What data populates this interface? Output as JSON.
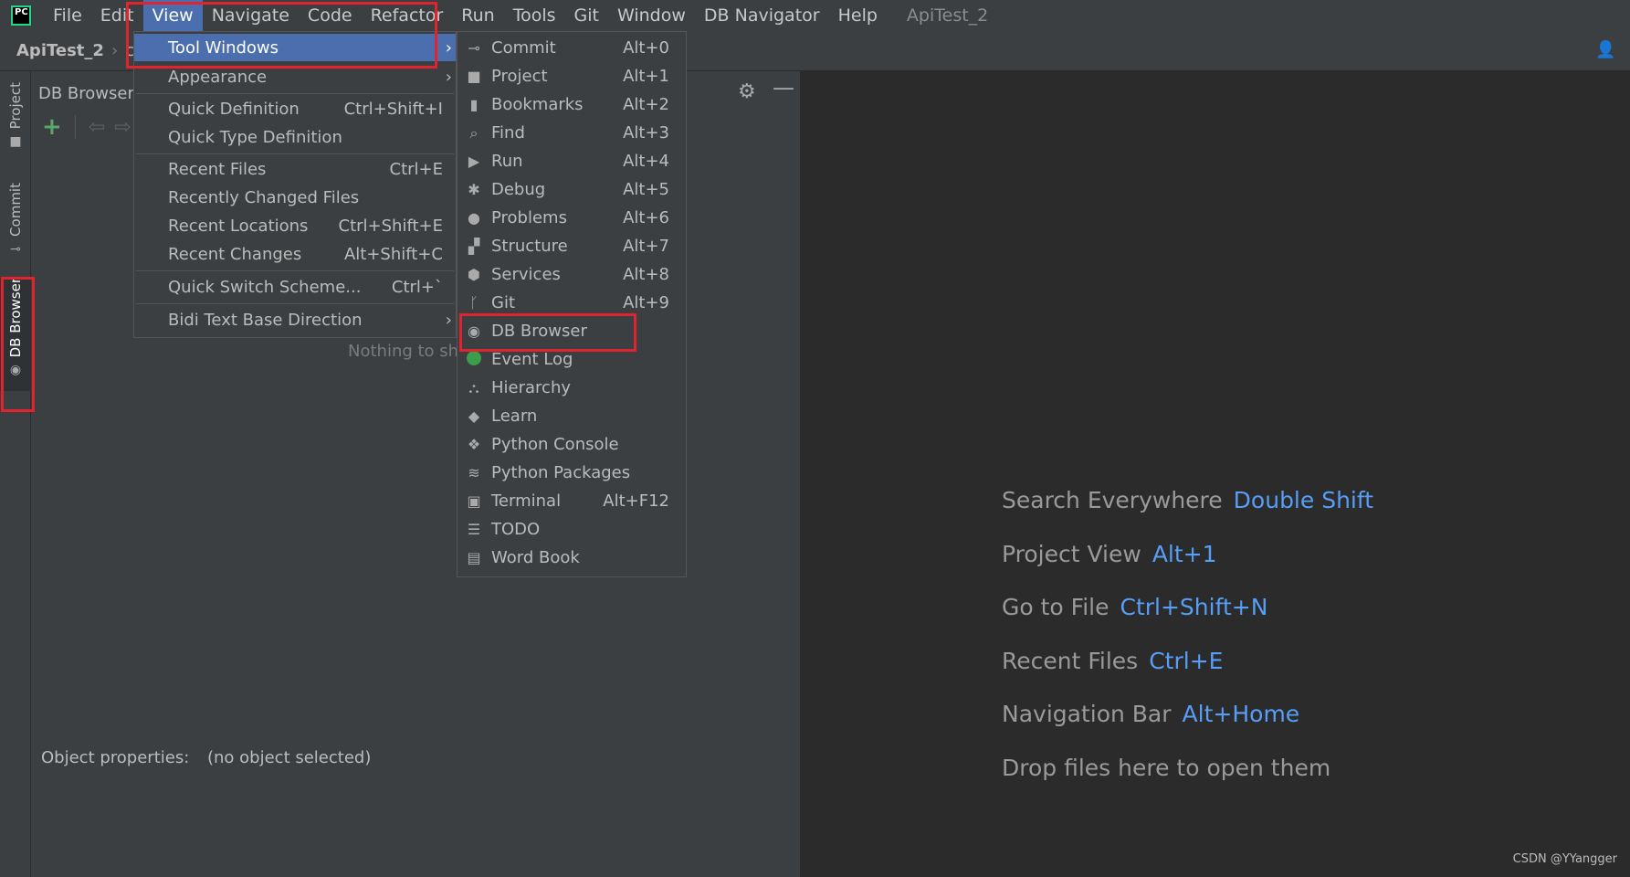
{
  "menubar": {
    "items": [
      "File",
      "Edit",
      "View",
      "Navigate",
      "Code",
      "Refactor",
      "Run",
      "Tools",
      "Git",
      "Window",
      "DB Navigator",
      "Help"
    ],
    "active_item": "View",
    "window_title": "ApiTest_2",
    "logo_text": "PC"
  },
  "navbar": {
    "project": "ApiTest_2",
    "crumb": "co"
  },
  "left_strip": {
    "tabs": [
      "Project",
      "Commit",
      "DB Browser"
    ]
  },
  "db_panel": {
    "title": "DB Browser",
    "empty_text": "Nothing to sh",
    "object_properties_label": "Object properties:",
    "object_properties_value": "(no object selected)"
  },
  "view_menu": {
    "items": [
      {
        "label": "Tool Windows",
        "shortcut": "",
        "submenu": true
      },
      {
        "label": "Appearance",
        "shortcut": "",
        "submenu": true
      },
      {
        "label": "Quick Definition",
        "shortcut": "Ctrl+Shift+I"
      },
      {
        "label": "Quick Type Definition",
        "shortcut": ""
      },
      {
        "label": "Recent Files",
        "shortcut": "Ctrl+E"
      },
      {
        "label": "Recently Changed Files",
        "shortcut": ""
      },
      {
        "label": "Recent Locations",
        "shortcut": "Ctrl+Shift+E"
      },
      {
        "label": "Recent Changes",
        "shortcut": "Alt+Shift+C"
      },
      {
        "label": "Quick Switch Scheme...",
        "shortcut": "Ctrl+`"
      },
      {
        "label": "Bidi Text Base Direction",
        "shortcut": "",
        "submenu": true
      }
    ]
  },
  "tool_windows_menu": {
    "items": [
      {
        "label": "Commit",
        "shortcut": "Alt+0",
        "icon": "commit-icon"
      },
      {
        "label": "Project",
        "shortcut": "Alt+1",
        "icon": "folder-icon"
      },
      {
        "label": "Bookmarks",
        "shortcut": "Alt+2",
        "icon": "bookmark-icon"
      },
      {
        "label": "Find",
        "shortcut": "Alt+3",
        "icon": "search-icon"
      },
      {
        "label": "Run",
        "shortcut": "Alt+4",
        "icon": "play-icon"
      },
      {
        "label": "Debug",
        "shortcut": "Alt+5",
        "icon": "bug-icon"
      },
      {
        "label": "Problems",
        "shortcut": "Alt+6",
        "icon": "warning-icon"
      },
      {
        "label": "Structure",
        "shortcut": "Alt+7",
        "icon": "structure-icon"
      },
      {
        "label": "Services",
        "shortcut": "Alt+8",
        "icon": "services-icon"
      },
      {
        "label": "Git",
        "shortcut": "Alt+9",
        "icon": "git-branch-icon"
      },
      {
        "label": "DB Browser",
        "shortcut": "",
        "icon": "db-browser-icon"
      },
      {
        "label": "Event Log",
        "shortcut": "",
        "icon": "event-log-icon"
      },
      {
        "label": "Hierarchy",
        "shortcut": "",
        "icon": "hierarchy-icon"
      },
      {
        "label": "Learn",
        "shortcut": "",
        "icon": "learn-icon"
      },
      {
        "label": "Python Console",
        "shortcut": "",
        "icon": "python-icon"
      },
      {
        "label": "Python Packages",
        "shortcut": "",
        "icon": "packages-icon"
      },
      {
        "label": "Terminal",
        "shortcut": "Alt+F12",
        "icon": "terminal-icon"
      },
      {
        "label": "TODO",
        "shortcut": "",
        "icon": "todo-icon"
      },
      {
        "label": "Word Book",
        "shortcut": "",
        "icon": "word-book-icon"
      }
    ]
  },
  "editor_tips": [
    {
      "label": "Search Everywhere",
      "key": "Double Shift"
    },
    {
      "label": "Project View",
      "key": "Alt+1"
    },
    {
      "label": "Go to File",
      "key": "Ctrl+Shift+N"
    },
    {
      "label": "Recent Files",
      "key": "Ctrl+E"
    },
    {
      "label": "Navigation Bar",
      "key": "Alt+Home"
    },
    {
      "label": "Drop files here to open them",
      "key": ""
    }
  ],
  "watermark": "CSDN @YYangger",
  "colors": {
    "accent": "#4b6eaf",
    "highlight_box": "#e0242f",
    "shortcut_blue": "#589df6"
  }
}
